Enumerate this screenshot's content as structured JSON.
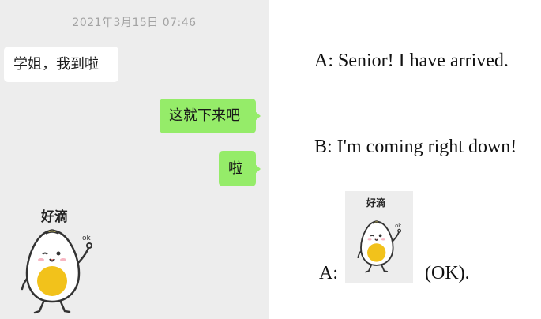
{
  "chat": {
    "timestamp": "2021年3月15日 07:46",
    "messages": [
      {
        "side": "left",
        "text": "学姐，我到啦"
      },
      {
        "side": "right",
        "text": "这就下来吧"
      },
      {
        "side": "right",
        "text": "啦"
      }
    ],
    "sticker": {
      "caption": "好滴",
      "small_text": "ok",
      "icon": "egg-waving-icon"
    }
  },
  "translation": {
    "line_a": "A: Senior! I have arrived.",
    "line_b": "B: I'm coming right down!",
    "line_c_label": "A:",
    "line_c_meaning": "(OK).",
    "sticker": {
      "caption": "好滴",
      "small_text": "ok",
      "icon": "egg-waving-icon"
    }
  },
  "colors": {
    "chat_background": "#ededed",
    "right_bubble": "#95ec69",
    "left_bubble": "#ffffff",
    "egg_yolk": "#f2c21b"
  }
}
